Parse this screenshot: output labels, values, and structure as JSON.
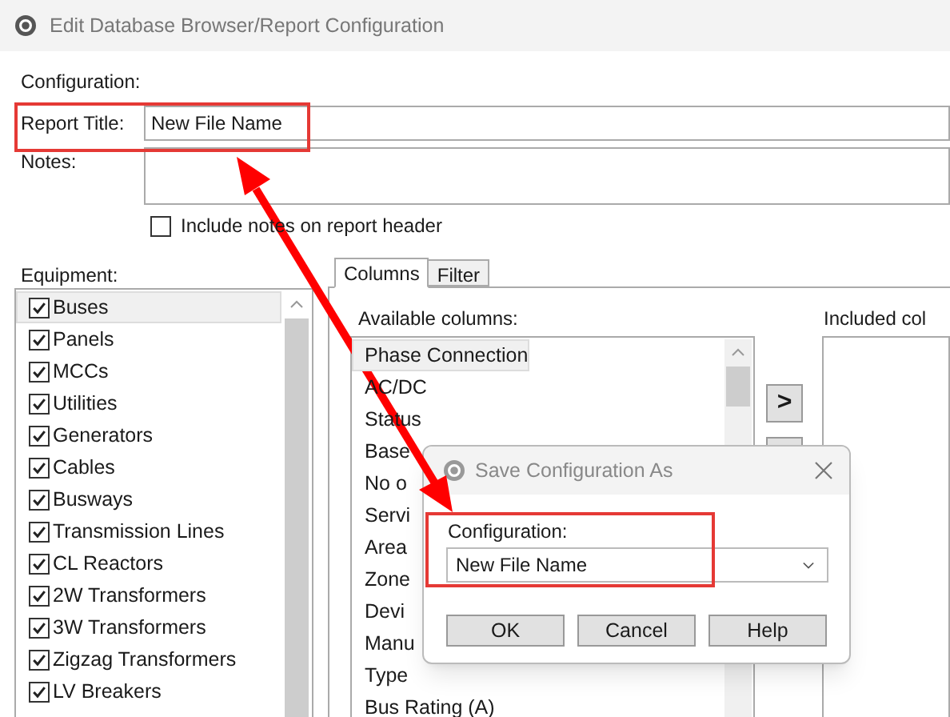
{
  "window": {
    "title": "Edit Database Browser/Report Configuration"
  },
  "form": {
    "configuration_label": "Configuration:",
    "report_title": {
      "label": "Report Title:",
      "value": "New File Name"
    },
    "notes": {
      "label": "Notes:"
    },
    "include_notes": {
      "label": "Include notes on report header",
      "checked": false
    }
  },
  "equipment": {
    "label": "Equipment:",
    "items": [
      {
        "label": "Buses",
        "checked": true,
        "selected": true
      },
      {
        "label": "Panels",
        "checked": true,
        "selected": false
      },
      {
        "label": "MCCs",
        "checked": true,
        "selected": false
      },
      {
        "label": "Utilities",
        "checked": true,
        "selected": false
      },
      {
        "label": "Generators",
        "checked": true,
        "selected": false
      },
      {
        "label": "Cables",
        "checked": true,
        "selected": false
      },
      {
        "label": "Busways",
        "checked": true,
        "selected": false
      },
      {
        "label": "Transmission Lines",
        "checked": true,
        "selected": false
      },
      {
        "label": "CL Reactors",
        "checked": true,
        "selected": false
      },
      {
        "label": "2W Transformers",
        "checked": true,
        "selected": false
      },
      {
        "label": "3W Transformers",
        "checked": true,
        "selected": false
      },
      {
        "label": "Zigzag Transformers",
        "checked": true,
        "selected": false
      },
      {
        "label": "LV Breakers",
        "checked": true,
        "selected": false
      }
    ]
  },
  "tabs": [
    {
      "label": "Columns",
      "selected": true
    },
    {
      "label": "Filter",
      "selected": false
    }
  ],
  "available_columns": {
    "label": "Available columns:",
    "items": [
      {
        "label": "Phase Connection",
        "selected": true
      },
      {
        "label": "AC/DC",
        "selected": false
      },
      {
        "label": "Status",
        "selected": false
      },
      {
        "label": "Base",
        "selected": false
      },
      {
        "label": "No o",
        "selected": false
      },
      {
        "label": "Servi",
        "selected": false
      },
      {
        "label": "Area",
        "selected": false
      },
      {
        "label": "Zone",
        "selected": false
      },
      {
        "label": "Devi",
        "selected": false
      },
      {
        "label": "Manu",
        "selected": false
      },
      {
        "label": "Type",
        "selected": false
      },
      {
        "label": "Bus Rating (A)",
        "selected": false
      }
    ]
  },
  "add_button": ">",
  "included_columns": {
    "label": "Included col"
  },
  "dialog": {
    "title": "Save Configuration As",
    "configuration_label": "Configuration:",
    "value": "New File Name",
    "buttons": [
      "OK",
      "Cancel",
      "Help"
    ]
  }
}
